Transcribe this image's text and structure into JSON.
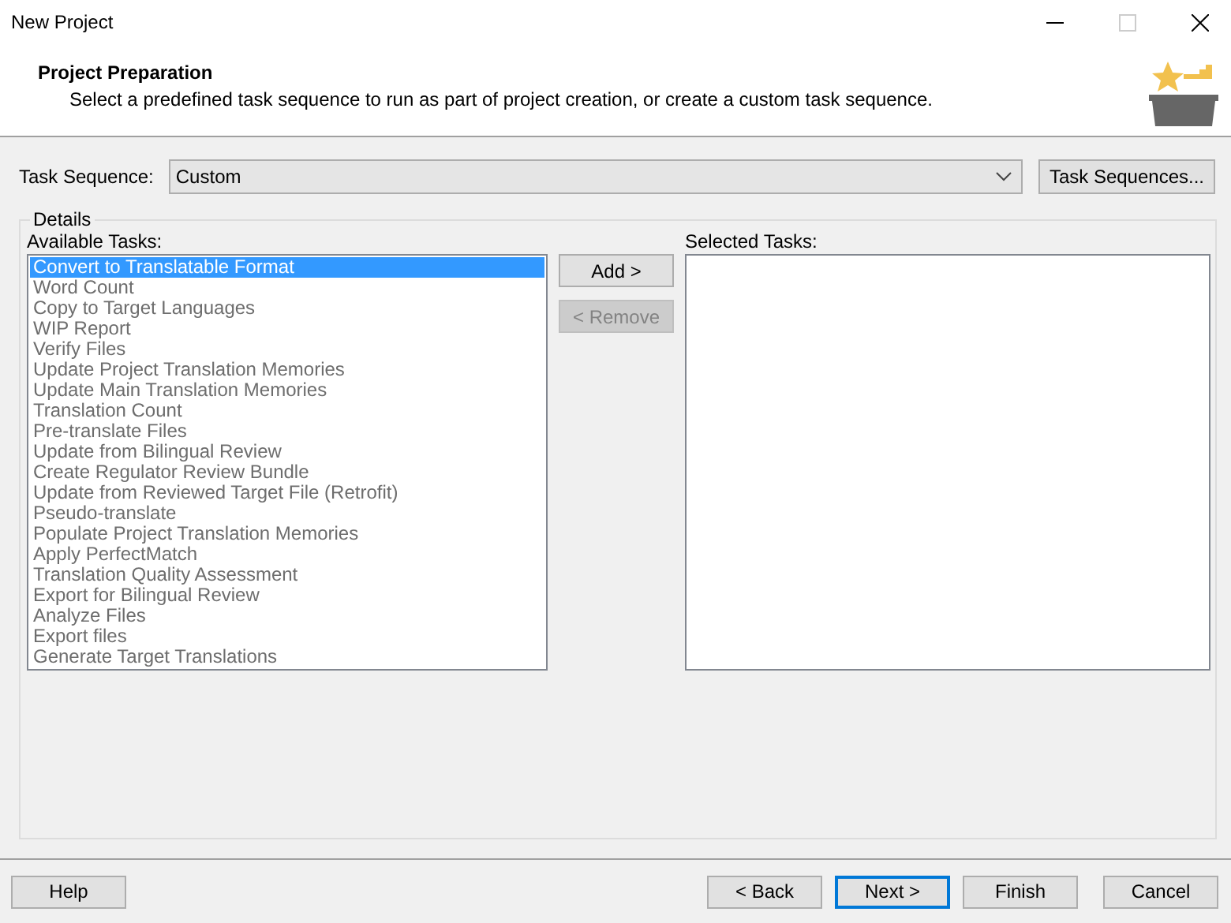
{
  "window": {
    "title": "New Project"
  },
  "header": {
    "title": "Project Preparation",
    "description": "Select a predefined task sequence to run as part of project creation, or create a custom task sequence."
  },
  "task_sequence": {
    "label": "Task Sequence:",
    "value": "Custom",
    "button": "Task Sequences..."
  },
  "details": {
    "title": "Details",
    "available_label": "Available Tasks:",
    "selected_label": "Selected Tasks:",
    "available_tasks": [
      {
        "label": "Convert to Translatable Format",
        "selected": true
      },
      {
        "label": "Word Count",
        "selected": false
      },
      {
        "label": "Copy to Target Languages",
        "selected": false
      },
      {
        "label": "WIP Report",
        "selected": false
      },
      {
        "label": "Verify Files",
        "selected": false
      },
      {
        "label": "Update Project Translation Memories",
        "selected": false
      },
      {
        "label": "Update Main Translation Memories",
        "selected": false
      },
      {
        "label": "Translation Count",
        "selected": false
      },
      {
        "label": "Pre-translate Files",
        "selected": false
      },
      {
        "label": "Update from Bilingual Review",
        "selected": false
      },
      {
        "label": "Create Regulator Review Bundle",
        "selected": false
      },
      {
        "label": "Update from Reviewed Target File (Retrofit)",
        "selected": false
      },
      {
        "label": "Pseudo-translate",
        "selected": false
      },
      {
        "label": "Populate Project Translation Memories",
        "selected": false
      },
      {
        "label": "Apply PerfectMatch",
        "selected": false
      },
      {
        "label": "Translation Quality Assessment",
        "selected": false
      },
      {
        "label": "Export for Bilingual Review",
        "selected": false
      },
      {
        "label": "Analyze Files",
        "selected": false
      },
      {
        "label": "Export files",
        "selected": false
      },
      {
        "label": "Generate Target Translations",
        "selected": false
      }
    ],
    "buttons": [
      {
        "label": "Add >",
        "disabled": false
      },
      {
        "label": "< Remove",
        "disabled": true
      }
    ]
  },
  "footer": {
    "help": "Help",
    "buttons": [
      {
        "label": "< Back",
        "default": false
      },
      {
        "label": "Next >",
        "default": true
      },
      {
        "label": "Finish",
        "default": false
      },
      {
        "label": "Cancel",
        "default": false
      }
    ]
  }
}
